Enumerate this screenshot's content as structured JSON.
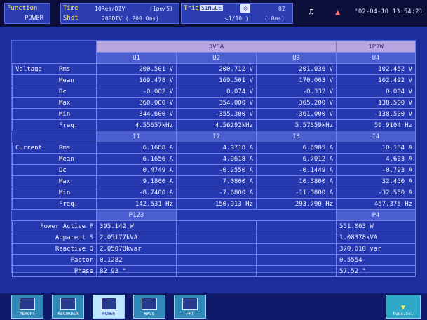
{
  "topbar": {
    "function_label": "Function",
    "function_value": "POWER",
    "time_label": "Time",
    "time_value": "10Res/DIV",
    "time_extra": "(1pe/S)",
    "shot_label": "Shot",
    "shot_value": "200DIV ( 200.0ms)",
    "trig_label": "Trig",
    "trig_value": "SINGLE",
    "trig_num": "02",
    "trig_line2": "<1/10 )",
    "trig_line3": "(.0ms)",
    "clock": "'02-04-10 13:54:21"
  },
  "table": {
    "group_left": "3V3A",
    "group_right": "1P2W",
    "voltage_label": "Voltage",
    "current_label": "Current",
    "v_headers": [
      "U1",
      "U2",
      "U3",
      "U4"
    ],
    "i_headers": [
      "I1",
      "I2",
      "I3",
      "I4"
    ],
    "p_headers": [
      "P123",
      "P4"
    ],
    "voltage_rows": [
      {
        "name": "Rms",
        "v": [
          "200.501 V",
          "200.712 V",
          "201.036 V",
          "102.452 V"
        ]
      },
      {
        "name": "Mean",
        "v": [
          "169.478 V",
          "169.501 V",
          "170.003 V",
          "102.492 V"
        ]
      },
      {
        "name": "Dc",
        "v": [
          "-0.002 V",
          "0.074 V",
          "-0.332 V",
          "0.004 V"
        ]
      },
      {
        "name": "Max",
        "v": [
          "360.000 V",
          "354.000 V",
          "365.200 V",
          "138.500 V"
        ]
      },
      {
        "name": "Min",
        "v": [
          "-344.600 V",
          "-355.300 V",
          "-361.000 V",
          "-138.500 V"
        ]
      },
      {
        "name": "Freq.",
        "v": [
          "4.55657kHz",
          "4.56292kHz",
          "5.57359kHz",
          "59.9104 Hz"
        ]
      }
    ],
    "current_rows": [
      {
        "name": "Rms",
        "v": [
          "6.1688 A",
          "4.9718 A",
          "6.6985 A",
          "10.184 A"
        ]
      },
      {
        "name": "Mean",
        "v": [
          "6.1656 A",
          "4.9618 A",
          "6.7012 A",
          "4.603 A"
        ]
      },
      {
        "name": "Dc",
        "v": [
          "0.4749 A",
          "-0.2550 A",
          "-0.1449 A",
          "-0.793 A"
        ]
      },
      {
        "name": "Max",
        "v": [
          "9.1800 A",
          "7.0800 A",
          "10.3800 A",
          "32.450 A"
        ]
      },
      {
        "name": "Min",
        "v": [
          "-8.7400 A",
          "-7.6800 A",
          "-11.3800 A",
          "-32.550 A"
        ]
      },
      {
        "name": "Freq.",
        "v": [
          "142.531 Hz",
          "150.913 Hz",
          "293.790 Hz",
          "457.375 Hz"
        ]
      }
    ],
    "power_rows": [
      {
        "name": "Power Active P",
        "left": "395.142 W",
        "right": "551.003 W"
      },
      {
        "name": "Apparent S",
        "left": "2.05177kVA",
        "right": "1.08378kVA"
      },
      {
        "name": "Reactive Q",
        "left": "2.05078kvar",
        "right": "370.610 var"
      },
      {
        "name": "Factor",
        "left": "0.1282",
        "right": "0.5554"
      },
      {
        "name": "Phase",
        "left": "82.93 °",
        "right": "57.52 °"
      }
    ]
  },
  "bottom_buttons": [
    {
      "label": "MEMORY",
      "selected": false
    },
    {
      "label": "RECORDER",
      "selected": false
    },
    {
      "label": "POWER",
      "selected": true
    },
    {
      "label": "WAVE",
      "selected": false
    },
    {
      "label": "FFT",
      "selected": false
    }
  ],
  "right_button": {
    "label": "Func.Sel"
  },
  "colors": {
    "background": "#1d2f9c",
    "band": "#b9a6e0",
    "topbar": "#0b0f3a"
  }
}
